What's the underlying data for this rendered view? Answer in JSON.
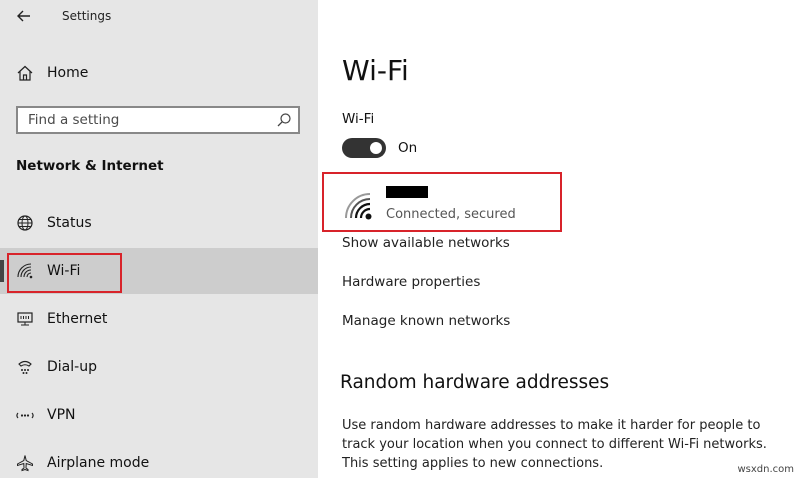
{
  "app": {
    "title": "Settings"
  },
  "sidebar": {
    "home_label": "Home",
    "search_placeholder": "Find a setting",
    "section_title": "Network & Internet",
    "items": [
      {
        "label": "Status",
        "icon": "globe-icon"
      },
      {
        "label": "Wi-Fi",
        "icon": "wifi-icon",
        "selected": true
      },
      {
        "label": "Ethernet",
        "icon": "ethernet-icon"
      },
      {
        "label": "Dial-up",
        "icon": "dialup-icon"
      },
      {
        "label": "VPN",
        "icon": "vpn-icon"
      },
      {
        "label": "Airplane mode",
        "icon": "airplane-icon"
      }
    ]
  },
  "main": {
    "page_title": "Wi-Fi",
    "wifi_toggle_label": "Wi-Fi",
    "wifi_toggle_state": "On",
    "network": {
      "status": "Connected, secured"
    },
    "links": [
      "Show available networks",
      "Hardware properties",
      "Manage known networks"
    ],
    "random_hw": {
      "title": "Random hardware addresses",
      "description": "Use random hardware addresses to make it harder for people to track your location when you connect to different Wi-Fi networks. This setting applies to new connections."
    }
  },
  "watermark": "wsxdn.com",
  "colors": {
    "sidebar_bg": "#e6e6e6",
    "selected_bg": "#cdcdcd",
    "highlight_red": "#d8232a",
    "toggle_on": "#333333"
  }
}
